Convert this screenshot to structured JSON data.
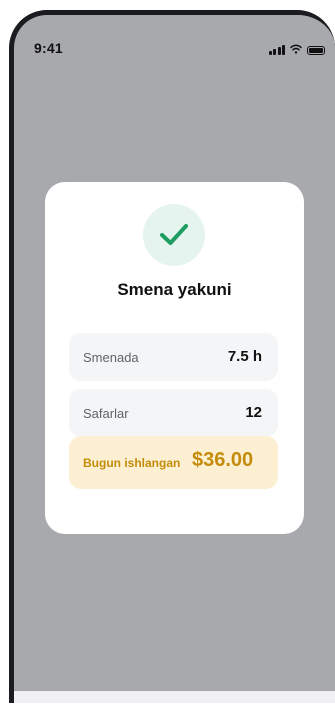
{
  "status_bar": {
    "time": "9:41",
    "icons": [
      "signal-icon",
      "wifi-icon",
      "battery-icon"
    ]
  },
  "modal": {
    "icon": "check-icon",
    "title": "Smena yakuni",
    "stats": [
      {
        "label": "Smenada",
        "value": "7.5 h"
      },
      {
        "label": "Safarlar",
        "value": "12"
      }
    ],
    "earned": {
      "label": "Bugun ishlangan",
      "value": "$36.00"
    }
  },
  "colors": {
    "overlay": "#a8a9ad",
    "success": "#1e9d62",
    "success_bg": "#e5f4ee",
    "earned_bg": "#fdf0d2",
    "earned_text": "#c58c0b"
  }
}
